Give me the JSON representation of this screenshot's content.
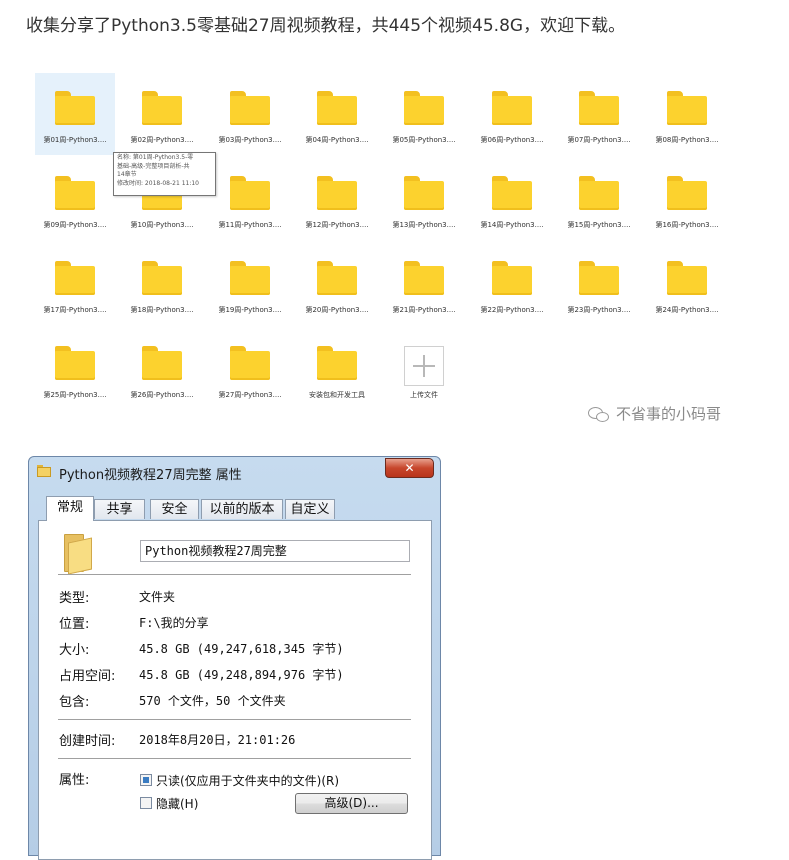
{
  "headline": "收集分享了Python3.5零基础27周视频教程，共445个视频45.8G，欢迎下载。",
  "explorer": {
    "folders": [
      "第01周-Python3....",
      "第02周-Python3....",
      "第03周-Python3....",
      "第04周-Python3....",
      "第05周-Python3....",
      "第06周-Python3....",
      "第07周-Python3....",
      "第08周-Python3....",
      "第09周-Python3....",
      "第10周-Python3....",
      "第11周-Python3....",
      "第12周-Python3....",
      "第13周-Python3....",
      "第14周-Python3....",
      "第15周-Python3....",
      "第16周-Python3....",
      "第17周-Python3....",
      "第18周-Python3....",
      "第19周-Python3....",
      "第20周-Python3....",
      "第21周-Python3....",
      "第22周-Python3....",
      "第23周-Python3....",
      "第24周-Python3....",
      "第25周-Python3....",
      "第26周-Python3....",
      "第27周-Python3....",
      "安装包和开发工具"
    ],
    "upload_label": "上传文件",
    "tooltip": {
      "line1": "名称: 第01周-Python3.5-零",
      "line2": "基础-高级-完整项目剖析-共",
      "line3": "14章节",
      "line4": "修改时间: 2018-08-21  11:10"
    },
    "folder_color": "#fcd22e"
  },
  "watermark": "不省事的小码哥",
  "dialog": {
    "title": "Python视频教程27周完整 属性",
    "close_label": "✕",
    "tabs": [
      "常规",
      "共享",
      "安全",
      "以前的版本",
      "自定义"
    ],
    "name": "Python视频教程27周完整",
    "props": {
      "type_label": "类型:",
      "type_value": "文件夹",
      "location_label": "位置:",
      "location_value": "F:\\我的分享",
      "size_label": "大小:",
      "size_value": "45.8 GB (49,247,618,345 字节)",
      "disk_label": "占用空间:",
      "disk_value": "45.8 GB (49,248,894,976 字节)",
      "contains_label": "包含:",
      "contains_value": "570 个文件，50 个文件夹",
      "created_label": "创建时间:",
      "created_value": "2018年8月20日，21:01:26",
      "attr_label": "属性:"
    },
    "readonly_label": "只读(仅应用于文件夹中的文件)(R)",
    "hidden_label": "隐藏(H)",
    "advanced_label": "高级(D)..."
  }
}
